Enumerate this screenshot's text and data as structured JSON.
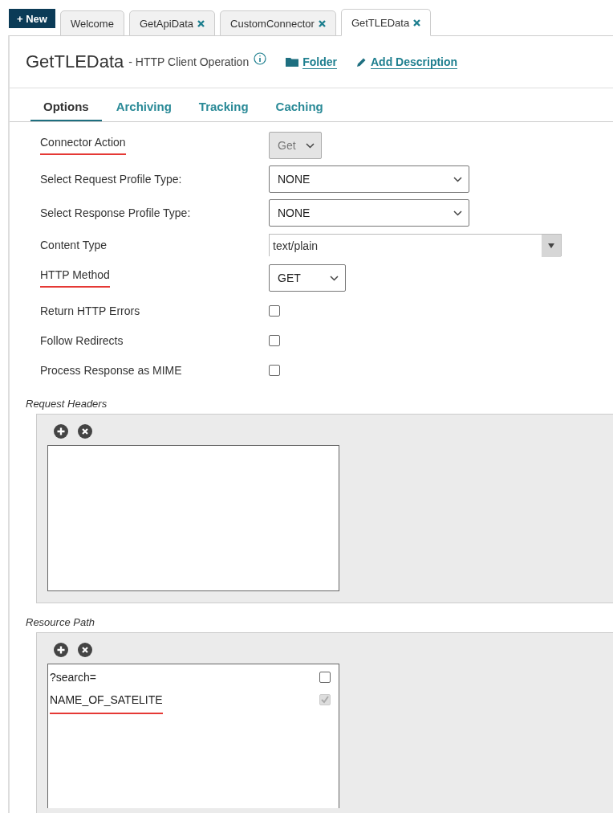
{
  "new_button": {
    "label": "+ New"
  },
  "tabs": [
    {
      "label": "Welcome",
      "closable": false,
      "selected": false
    },
    {
      "label": "GetApiData",
      "closable": true,
      "selected": false
    },
    {
      "label": "CustomConnector",
      "closable": true,
      "selected": false
    },
    {
      "label": "GetTLEData",
      "closable": true,
      "selected": true
    }
  ],
  "header": {
    "title": "GetTLEData",
    "subtitle": "- HTTP Client Operation",
    "folder_link": "Folder",
    "description_link": "Add Description"
  },
  "subtabs": [
    {
      "label": "Options",
      "selected": true
    },
    {
      "label": "Archiving",
      "selected": false
    },
    {
      "label": "Tracking",
      "selected": false
    },
    {
      "label": "Caching",
      "selected": false
    }
  ],
  "fields": [
    {
      "label": "Connector Action",
      "kind": "mini-select",
      "value": "Get",
      "disabled": true,
      "underlined": true
    },
    {
      "label": "Select Request Profile Type:",
      "kind": "select",
      "value": "NONE",
      "disabled": false,
      "underlined": false
    },
    {
      "label": "Select Response Profile Type:",
      "kind": "select",
      "value": "NONE",
      "disabled": false,
      "underlined": false
    },
    {
      "label": "Content Type",
      "kind": "combo",
      "value": "text/plain",
      "underlined": false
    },
    {
      "label": "HTTP Method",
      "kind": "small-select",
      "value": "GET",
      "disabled": false,
      "underlined": true
    },
    {
      "label": "Return HTTP Errors",
      "kind": "checkbox",
      "checked": false,
      "underlined": false
    },
    {
      "label": "Follow Redirects",
      "kind": "checkbox",
      "checked": false,
      "underlined": false
    },
    {
      "label": "Process Response as MIME",
      "kind": "checkbox",
      "checked": false,
      "underlined": false
    }
  ],
  "request_headers": {
    "title": "Request Headers"
  },
  "resource_path": {
    "title": "Resource Path",
    "rows": [
      {
        "text": "?search=",
        "checked": false,
        "disabled": false,
        "underlined": false
      },
      {
        "text": "NAME_OF_SATELITE",
        "checked": true,
        "disabled": true,
        "underlined": true
      }
    ]
  }
}
